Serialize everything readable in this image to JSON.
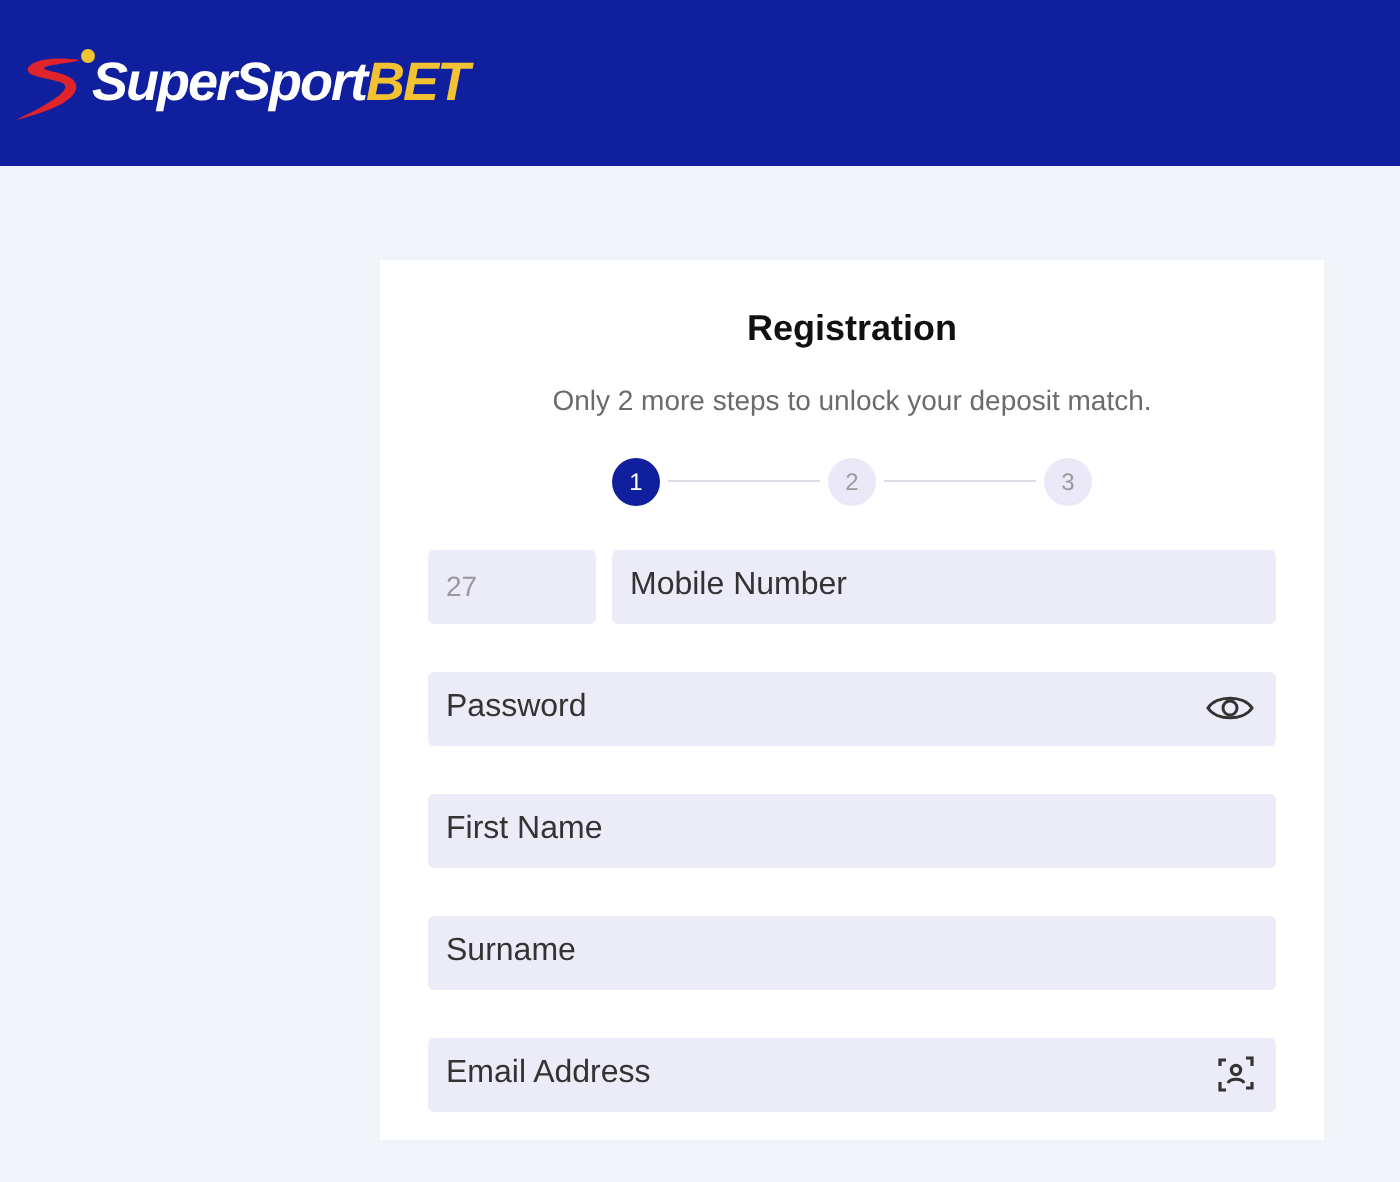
{
  "header": {
    "logo": {
      "text": "SuperSport",
      "accent": "BET"
    }
  },
  "form": {
    "title": "Registration",
    "subtitle": "Only 2 more steps to unlock your deposit match.",
    "steps": [
      {
        "label": "1",
        "selected": true
      },
      {
        "label": "2",
        "selected": false
      },
      {
        "label": "3",
        "selected": false
      }
    ],
    "fields": [
      {
        "kind": "phone",
        "code": "27",
        "placeholder": "Mobile Number"
      },
      {
        "kind": "password",
        "placeholder": "Password"
      },
      {
        "kind": "text",
        "placeholder": "First Name"
      },
      {
        "kind": "text",
        "placeholder": "Surname"
      },
      {
        "kind": "email",
        "placeholder": "Email Address"
      }
    ]
  }
}
